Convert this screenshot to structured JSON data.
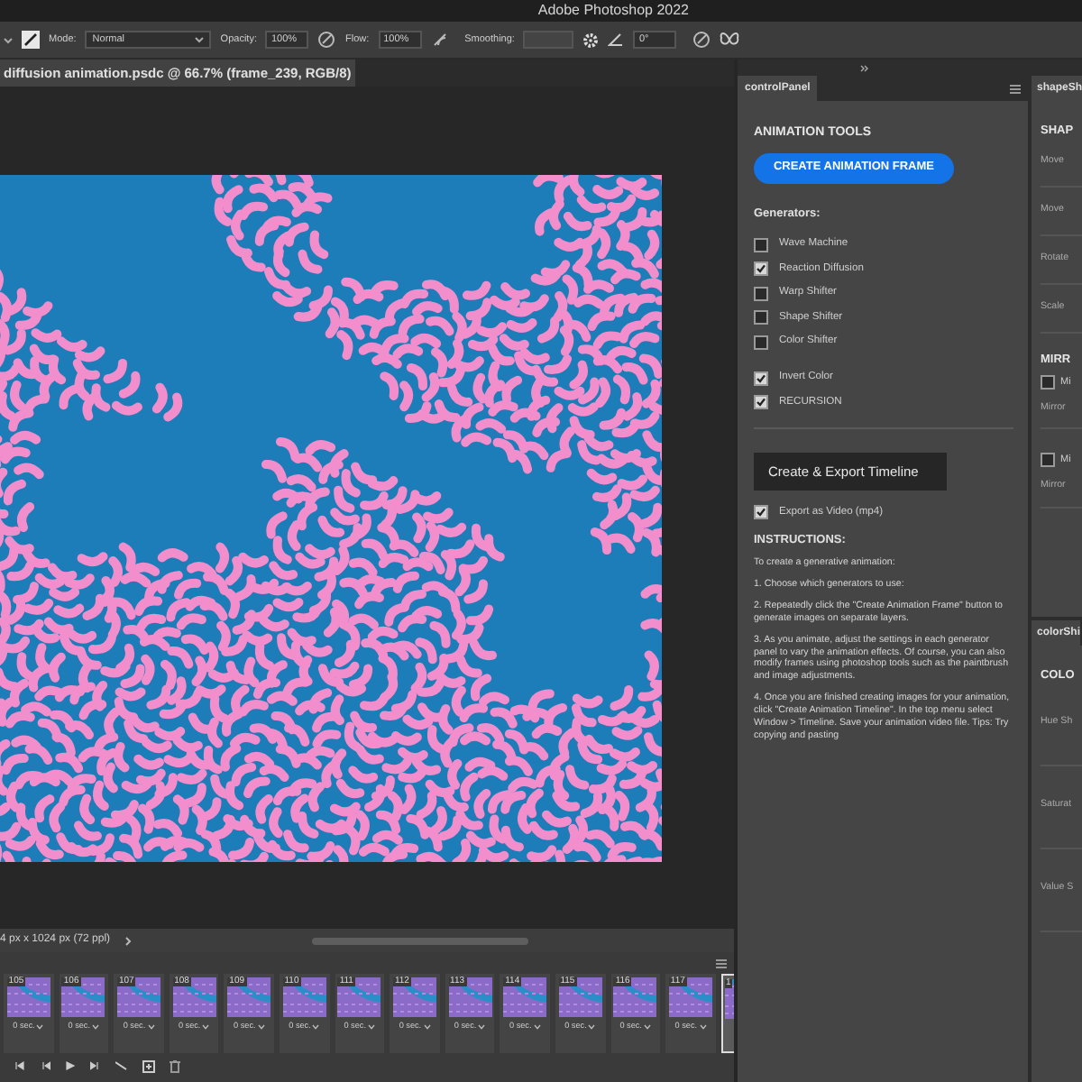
{
  "app_title": "Adobe Photoshop 2022",
  "options_bar": {
    "mode_label": "Mode:",
    "mode_value": "Normal",
    "opacity_label": "Opacity:",
    "opacity_value": "100%",
    "flow_label": "Flow:",
    "flow_value": "100%",
    "smoothing_label": "Smoothing:",
    "angle_value": "0°"
  },
  "document_tab": {
    "title": "diffusion animation.psdc @ 66.7% (frame_239, RGB/8)"
  },
  "status_bar": {
    "doc_size": "4 px x 1024 px (72 ppl)"
  },
  "control_panel": {
    "tab": "controlPanel",
    "heading": "ANIMATION TOOLS",
    "create_button": "CREATE ANIMATION FRAME",
    "generators_label": "Generators:",
    "generators": [
      {
        "label": "Wave Machine",
        "checked": false
      },
      {
        "label": "Reaction Diffusion",
        "checked": true
      },
      {
        "label": "Warp Shifter",
        "checked": false
      },
      {
        "label": "Shape Shifter",
        "checked": false
      },
      {
        "label": "Color Shifter",
        "checked": false
      }
    ],
    "options": [
      {
        "label": "Invert Color",
        "checked": true
      },
      {
        "label": "RECURSION",
        "checked": true
      }
    ],
    "export_button": "Create & Export Timeline",
    "export_video": {
      "label": "Export as Video (mp4)",
      "checked": true
    },
    "instructions_heading": "INSTRUCTIONS:",
    "instructions": [
      "To create a generative animation:",
      "1. Choose which generators to use:",
      "2. Repeatedly click the \"Create Animation Frame\" button to generate images on separate layers.",
      "3. As you animate, adjust the settings in each generator panel to vary the animation effects. Of course, you can also modify frames using photoshop tools such as the paintbrush and image adjustments.",
      "4. Once you are finished creating images for your animation, click \"Create Animation Timeline\". In the top menu select Window > Timeline. Save your animation video file. Tips: Try copying and pasting"
    ]
  },
  "shape_panel": {
    "tab": "shapeSh",
    "heading": "SHAP",
    "fields": [
      "Move",
      "Move",
      "Rotate",
      "Scale"
    ],
    "mirror_heading": "MIRR",
    "mirror_rows": [
      {
        "kind": "checkbox",
        "label": "Mi",
        "checked": false
      },
      {
        "kind": "field",
        "label": "Mirror"
      },
      {
        "kind": "checkbox",
        "label": "Mi",
        "checked": false
      },
      {
        "kind": "field",
        "label": "Mirror"
      }
    ]
  },
  "color_panel": {
    "tab": "colorShi",
    "heading": "COLO",
    "fields": [
      "Hue Sh",
      "Saturat",
      "Value S"
    ]
  },
  "timeline": {
    "frames": [
      {
        "number": "105",
        "delay": "0 sec.",
        "selected": false
      },
      {
        "number": "106",
        "delay": "0 sec.",
        "selected": false
      },
      {
        "number": "107",
        "delay": "0 sec.",
        "selected": false
      },
      {
        "number": "108",
        "delay": "0 sec.",
        "selected": false
      },
      {
        "number": "109",
        "delay": "0 sec.",
        "selected": false
      },
      {
        "number": "110",
        "delay": "0 sec.",
        "selected": false
      },
      {
        "number": "111",
        "delay": "0 sec.",
        "selected": false
      },
      {
        "number": "112",
        "delay": "0 sec.",
        "selected": false
      },
      {
        "number": "113",
        "delay": "0 sec.",
        "selected": false
      },
      {
        "number": "114",
        "delay": "0 sec.",
        "selected": false
      },
      {
        "number": "115",
        "delay": "0 sec.",
        "selected": false
      },
      {
        "number": "116",
        "delay": "0 sec.",
        "selected": false
      },
      {
        "number": "117",
        "delay": "0 sec.",
        "selected": false
      },
      {
        "number": "1",
        "selected": true
      }
    ]
  }
}
